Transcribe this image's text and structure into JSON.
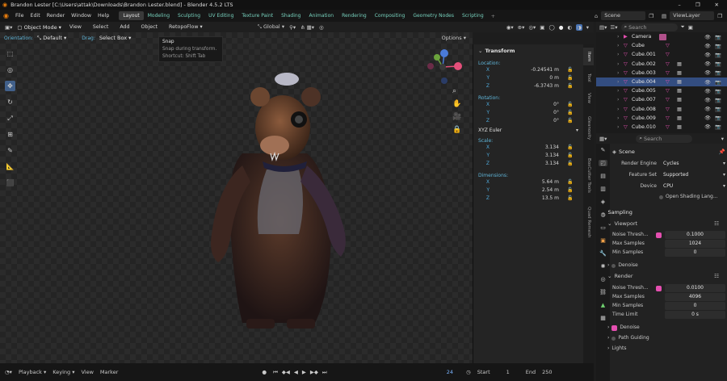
{
  "window": {
    "title": "Brandon Lester [C:\\Users\\attak\\Downloads\\Brandon Lester.blend] - Blender 4.5.2 LTS",
    "min": "–",
    "max": "❐",
    "close": "✕"
  },
  "menu": [
    "File",
    "Edit",
    "Render",
    "Window",
    "Help"
  ],
  "workspaces": [
    {
      "label": "Layout",
      "active": true
    },
    {
      "label": "Modeling"
    },
    {
      "label": "Sculpting"
    },
    {
      "label": "UV Editing"
    },
    {
      "label": "Texture Paint"
    },
    {
      "label": "Shading"
    },
    {
      "label": "Animation"
    },
    {
      "label": "Rendering"
    },
    {
      "label": "Compositing"
    },
    {
      "label": "Geometry Nodes"
    },
    {
      "label": "Scripting"
    }
  ],
  "scene_field": "Scene",
  "viewlayer_field": "ViewLayer",
  "header": {
    "mode": "Object Mode",
    "view": "View",
    "select": "Select",
    "add": "Add",
    "object": "Object",
    "addon": "RetopoFlow",
    "orientation_label": "Orientation:",
    "orientation": "Default",
    "drag_label": "Drag:",
    "drag": "Select Box",
    "transform_orient": "Global",
    "options": "Options"
  },
  "tooltip": {
    "title": "Snap",
    "desc": "Snap during transform.",
    "shortcut": "Shortcut: Shift Tab"
  },
  "transform": {
    "title": "Transform",
    "location_label": "Location:",
    "location": [
      {
        "axis": "X",
        "value": "-0.24541 m"
      },
      {
        "axis": "Y",
        "value": "0 m"
      },
      {
        "axis": "Z",
        "value": "-6.3743 m"
      }
    ],
    "rotation_label": "Rotation:",
    "rotation": [
      {
        "axis": "X",
        "value": "0°"
      },
      {
        "axis": "Y",
        "value": "0°"
      },
      {
        "axis": "Z",
        "value": "0°"
      }
    ],
    "rotation_mode": "XYZ Euler",
    "scale_label": "Scale:",
    "scale": [
      {
        "axis": "X",
        "value": "3.134"
      },
      {
        "axis": "Y",
        "value": "3.134"
      },
      {
        "axis": "Z",
        "value": "3.134"
      }
    ],
    "dimensions_label": "Dimensions:",
    "dimensions": [
      {
        "axis": "X",
        "value": "5.64 m"
      },
      {
        "axis": "Y",
        "value": "2.54 m"
      },
      {
        "axis": "Z",
        "value": "13.5 m"
      }
    ]
  },
  "side_tabs": [
    "Item",
    "Tool",
    "View",
    "Gleanosity",
    "BoxCutter Tools",
    "Quad Remesh"
  ],
  "outliner": {
    "search": "Search",
    "items": [
      {
        "name": "Camera",
        "sel": false,
        "cam": true
      },
      {
        "name": "Cube",
        "sel": false
      },
      {
        "name": "Cube.001",
        "sel": false
      },
      {
        "name": "Cube.002",
        "sel": false
      },
      {
        "name": "Cube.003",
        "sel": false
      },
      {
        "name": "Cube.004",
        "sel": true
      },
      {
        "name": "Cube.005",
        "sel": false
      },
      {
        "name": "Cube.007",
        "sel": false
      },
      {
        "name": "Cube.008",
        "sel": false
      },
      {
        "name": "Cube.009",
        "sel": false
      },
      {
        "name": "Cube.010",
        "sel": false
      }
    ]
  },
  "props": {
    "search": "Search",
    "scene": "Scene",
    "render_engine_label": "Render Engine",
    "render_engine": "Cycles",
    "feature_set_label": "Feature Set",
    "feature_set": "Supported",
    "device_label": "Device",
    "device": "CPU",
    "osl": "Open Shading Lang...",
    "sampling": "Sampling",
    "viewport": "Viewport",
    "vp_noise_label": "Noise Thresh...",
    "vp_noise": "0.1000",
    "vp_max_label": "Max Samples",
    "vp_max": "1024",
    "vp_min_label": "Min Samples",
    "vp_min": "0",
    "denoise1": "Denoise",
    "render": "Render",
    "r_noise_label": "Noise Thresh...",
    "r_noise": "0.0100",
    "r_max_label": "Max Samples",
    "r_max": "4096",
    "r_min_label": "Min Samples",
    "r_min": "0",
    "time_limit_label": "Time Limit",
    "time_limit": "0 s",
    "denoise2": "Denoise",
    "path_guiding": "Path Guiding",
    "lights": "Lights"
  },
  "timeline": {
    "playback": "Playback",
    "keying": "Keying",
    "view": "View",
    "marker": "Marker",
    "frame": "24",
    "start_label": "Start",
    "start": "1",
    "end_label": "End",
    "end": "250"
  }
}
